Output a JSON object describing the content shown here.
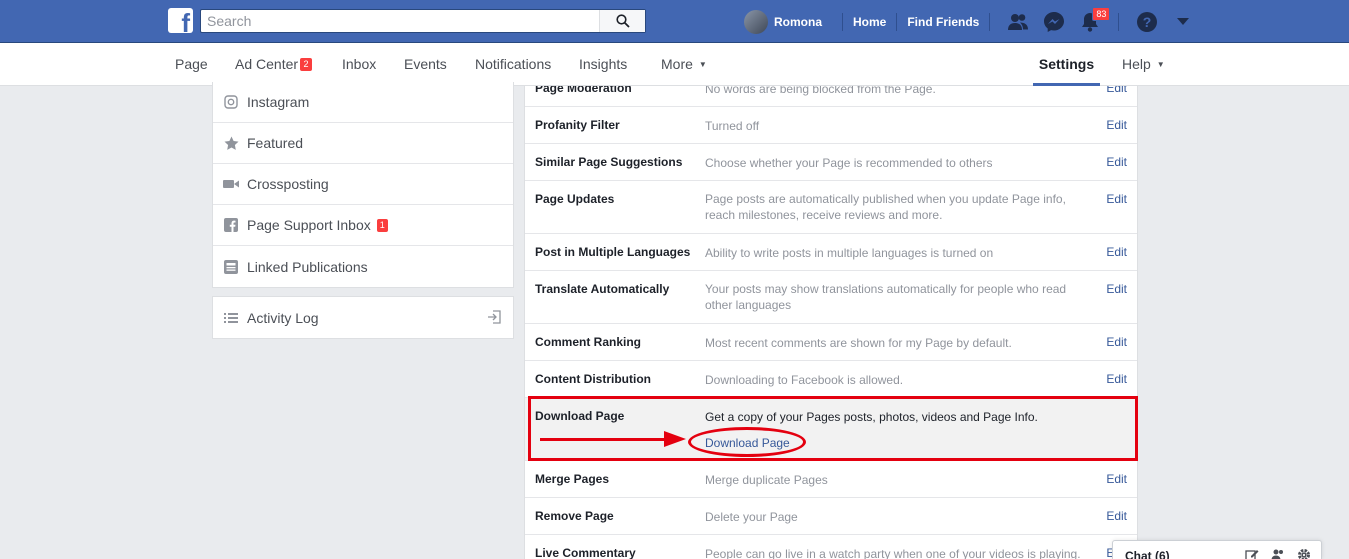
{
  "topbar": {
    "logo_letter": "f",
    "search_placeholder": "Search",
    "profile_name": "Romona",
    "home_label": "Home",
    "find_friends_label": "Find Friends",
    "notification_count": "83"
  },
  "subnav": {
    "page": "Page",
    "ad_center": "Ad Center",
    "ad_center_badge": "2",
    "inbox": "Inbox",
    "events": "Events",
    "notifications": "Notifications",
    "insights": "Insights",
    "more": "More",
    "settings": "Settings",
    "help": "Help"
  },
  "sidebar": {
    "items": [
      {
        "label": "Instagram",
        "icon": "instagram-icon"
      },
      {
        "label": "Featured",
        "icon": "star-icon"
      },
      {
        "label": "Crossposting",
        "icon": "video-camera-icon"
      },
      {
        "label": "Page Support Inbox",
        "icon": "facebook-square-icon",
        "badge": "1"
      },
      {
        "label": "Linked Publications",
        "icon": "newspaper-icon"
      }
    ],
    "activity_log": "Activity Log"
  },
  "settings": {
    "edit_label": "Edit",
    "rows": [
      {
        "name": "Page Moderation",
        "desc": "No words are being blocked from the Page."
      },
      {
        "name": "Profanity Filter",
        "desc": "Turned off"
      },
      {
        "name": "Similar Page Suggestions",
        "desc": "Choose whether your Page is recommended to others"
      },
      {
        "name": "Page Updates",
        "desc": "Page posts are automatically published when you update Page info, reach milestones, receive reviews and more."
      },
      {
        "name": "Post in Multiple Languages",
        "desc": "Ability to write posts in multiple languages is turned on"
      },
      {
        "name": "Translate Automatically",
        "desc": "Your posts may show translations automatically for people who read other languages"
      },
      {
        "name": "Comment Ranking",
        "desc": "Most recent comments are shown for my Page by default."
      },
      {
        "name": "Content Distribution",
        "desc": "Downloading to Facebook is allowed."
      },
      {
        "name": "Download Page",
        "desc": "Get a copy of your Pages posts, photos, videos and Page Info.",
        "link": "Download Page"
      },
      {
        "name": "Merge Pages",
        "desc": "Merge duplicate Pages"
      },
      {
        "name": "Remove Page",
        "desc": "Delete your Page"
      },
      {
        "name": "Live Commentary",
        "desc": "People can go live in a watch party when one of your videos is playing."
      }
    ]
  },
  "chat": {
    "title": "Chat (6)"
  },
  "colors": {
    "brand_blue": "#4267b2",
    "link_blue": "#365899",
    "annotation_red": "#e4000f"
  }
}
